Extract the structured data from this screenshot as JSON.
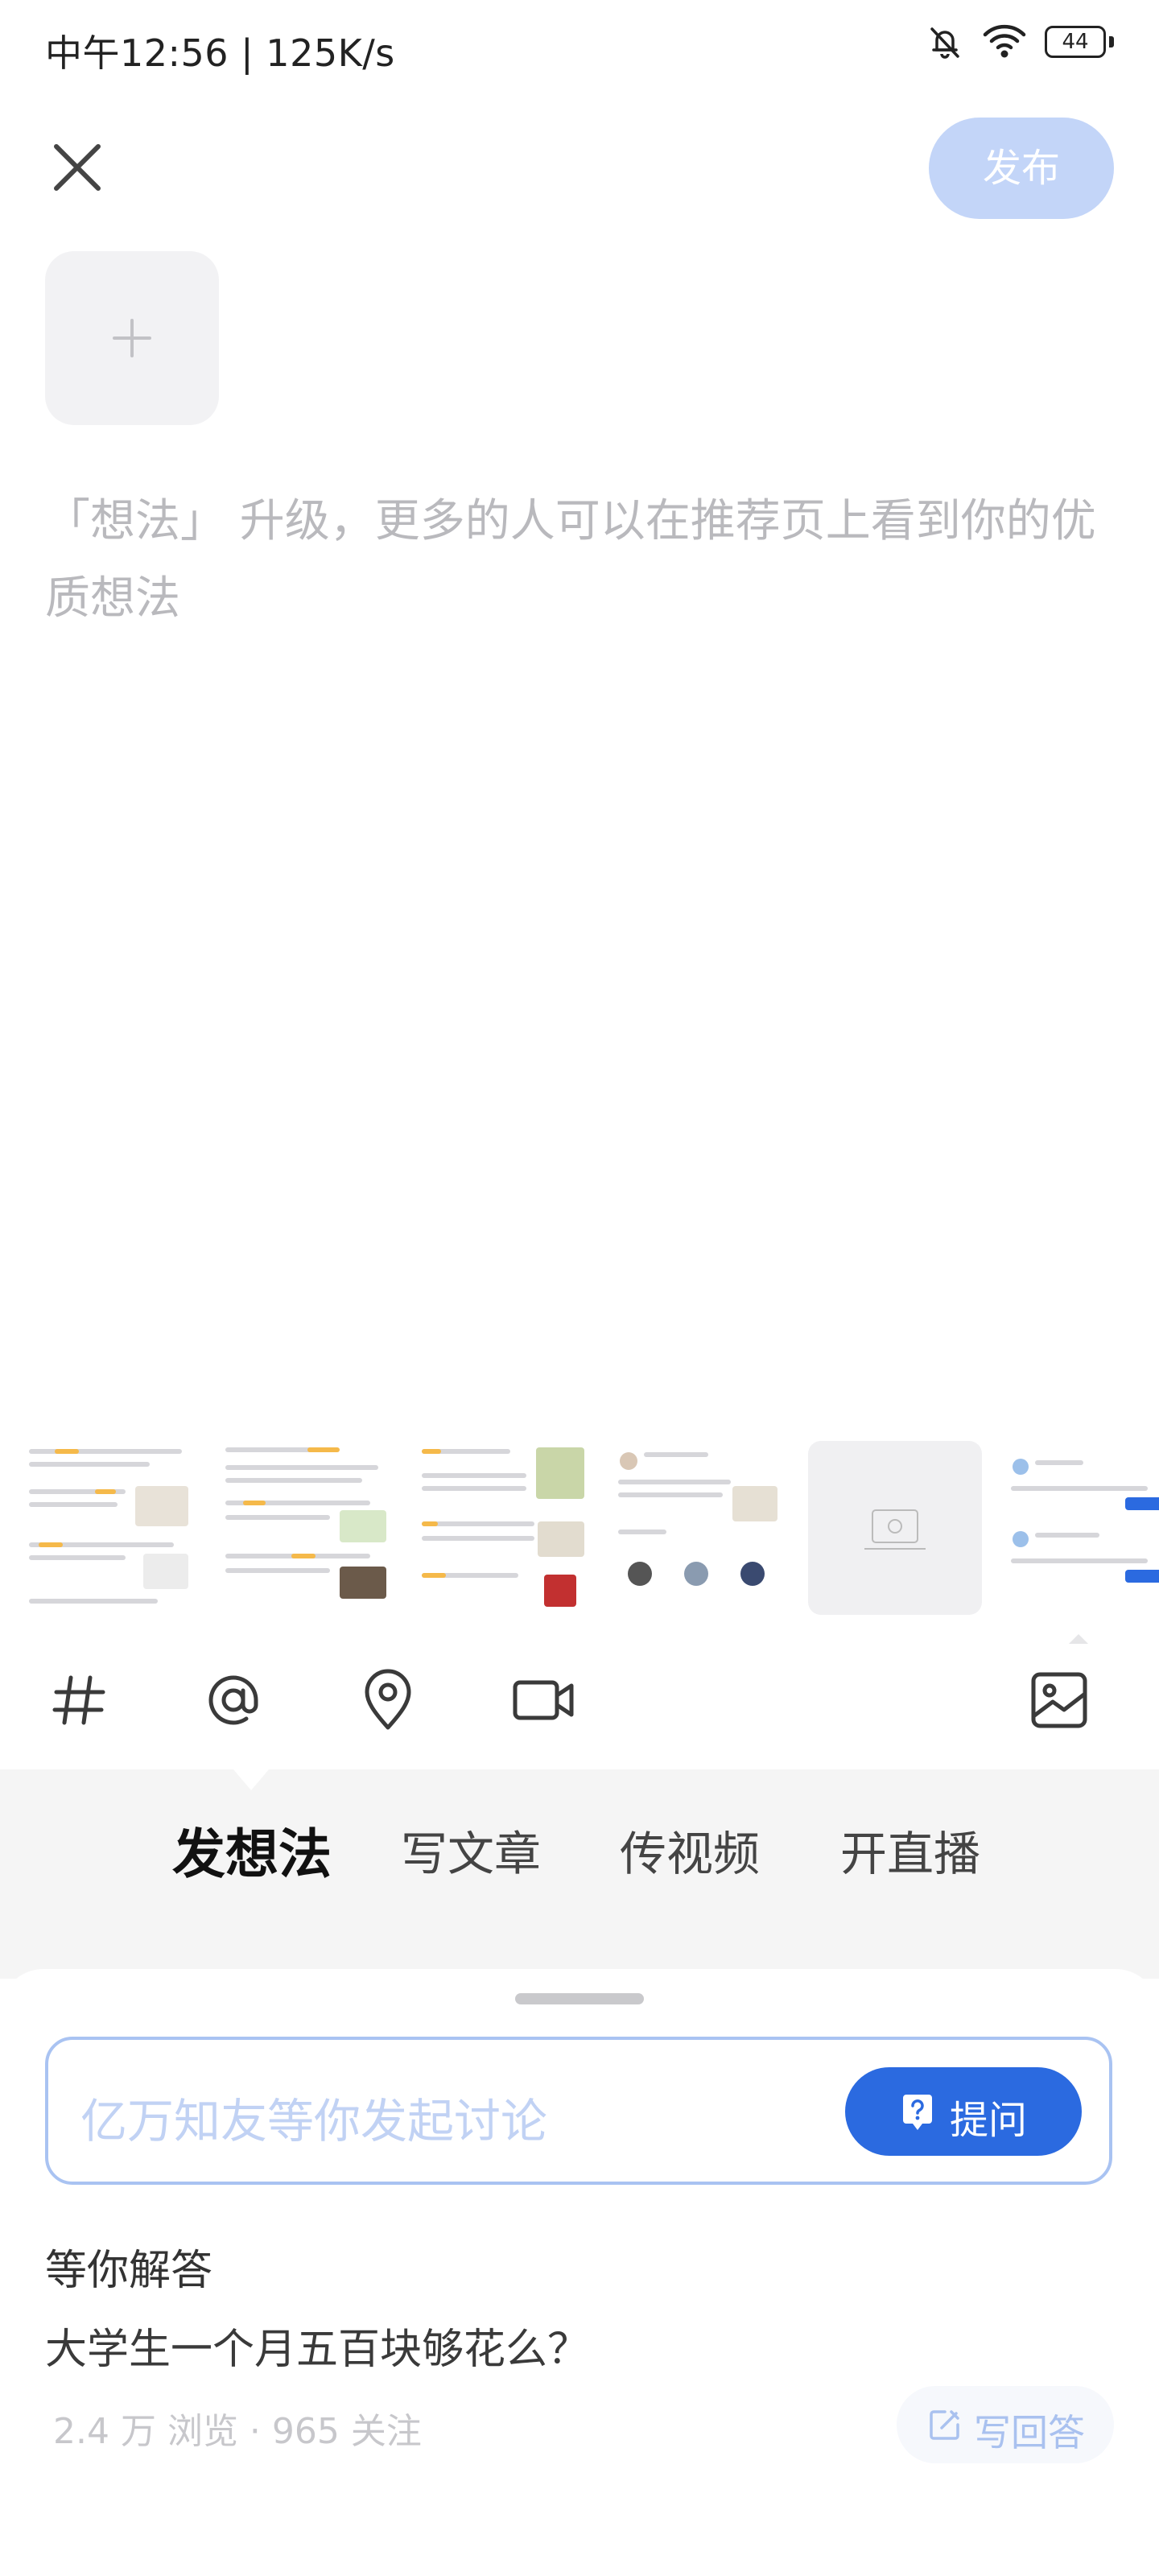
{
  "status_bar": {
    "time": "中午12:56 | 125K/s",
    "battery": "44",
    "icons": [
      "mute-bell-icon",
      "wifi-icon",
      "battery-icon"
    ]
  },
  "header": {
    "close_icon": "close-icon",
    "publish_label": "发布"
  },
  "editor": {
    "add_image_icon": "plus-icon",
    "placeholder": "「想法」 升级，更多的人可以在推荐页上看到你的优质想法"
  },
  "toolbar": {
    "icons": [
      "hashtag-icon",
      "mention-icon",
      "location-icon",
      "video-icon",
      "image-icon"
    ]
  },
  "tabs": [
    {
      "label": "发想法",
      "active": true
    },
    {
      "label": "写文章",
      "active": false
    },
    {
      "label": "传视频",
      "active": false
    },
    {
      "label": "开直播",
      "active": false
    }
  ],
  "ask": {
    "placeholder": "亿万知友等你发起讨论",
    "button_label": "提问"
  },
  "answer_section": {
    "title": "等你解答",
    "question": "大学生一个月五百块够花么？",
    "meta": "2.4 万 浏览 · 965 关注",
    "answer_button": "写回答"
  },
  "colors": {
    "accent": "#2b6ae0",
    "publish_disabled": "#c3d5f8",
    "placeholder": "#b9b9bd"
  }
}
